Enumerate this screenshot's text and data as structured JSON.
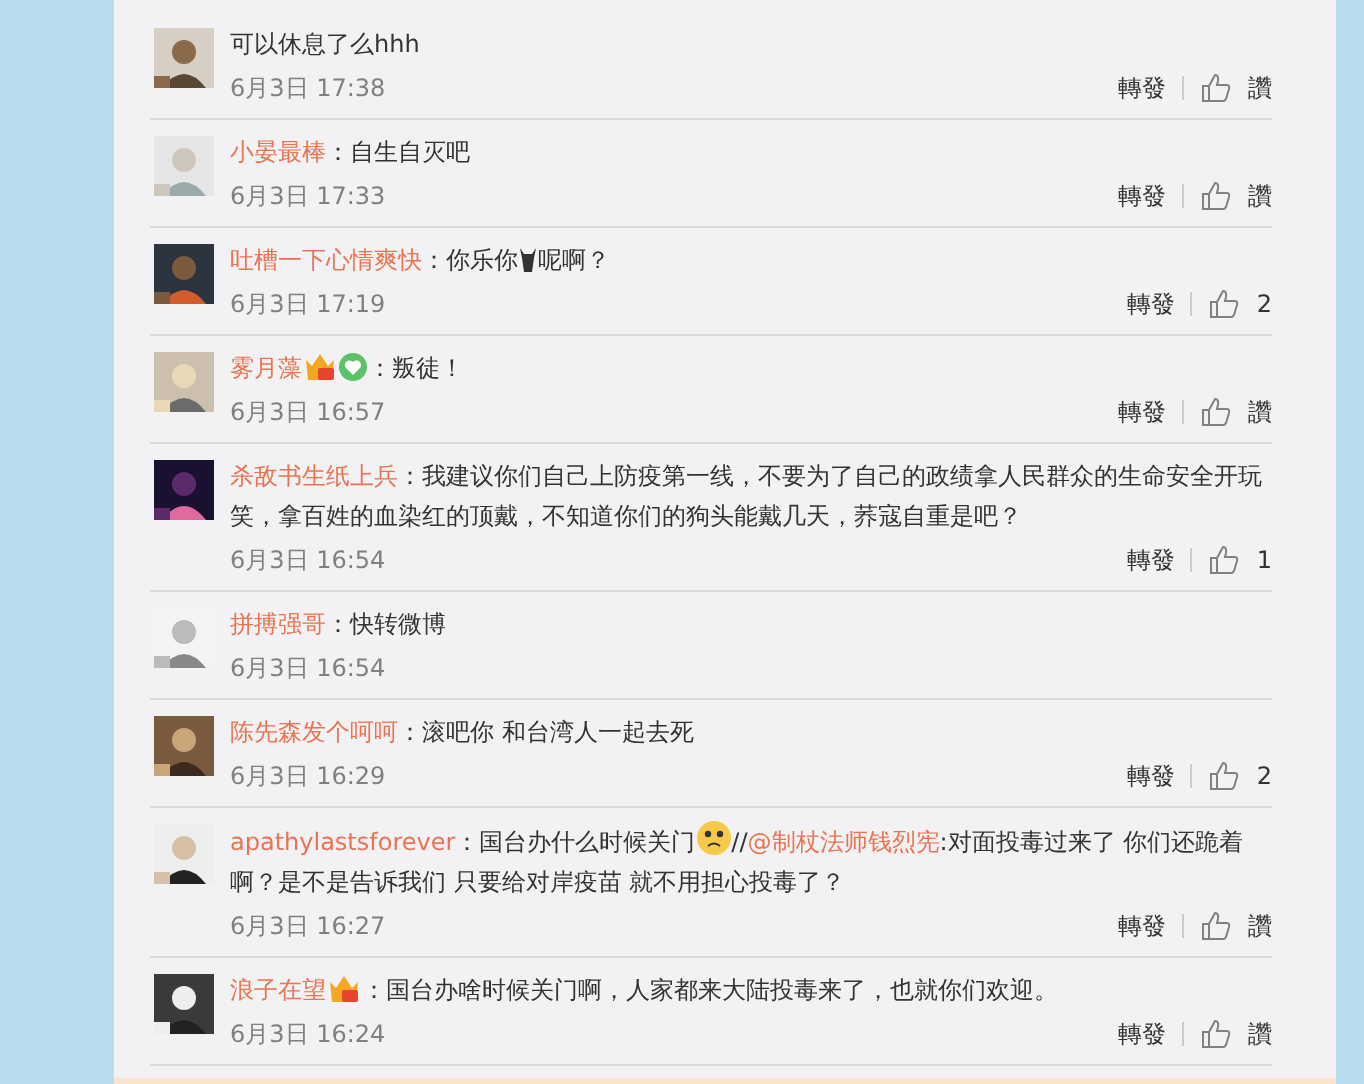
{
  "comments": [
    {
      "segments": [
        {
          "kind": "text",
          "text": "可以休息了么hhh"
        }
      ],
      "time": "6月3日 17:38",
      "forward": "轉發",
      "like": "讚"
    },
    {
      "user": "小晏最棒",
      "segments": [
        {
          "kind": "text",
          "text": "：自生自灭吧"
        }
      ],
      "time": "6月3日 17:33",
      "forward": "轉發",
      "like": "讚"
    },
    {
      "user": "吐槽一下心情爽快",
      "segments": [
        {
          "kind": "text",
          "text": "：你乐你"
        },
        {
          "kind": "emoji"
        },
        {
          "kind": "text",
          "text": "呢啊？"
        }
      ],
      "time": "6月3日 17:19",
      "forward": "轉發",
      "like": "2"
    },
    {
      "user": "雾月藻",
      "badges": [
        {
          "kind": "crown"
        },
        {
          "kind": "heart"
        }
      ],
      "segments": [
        {
          "kind": "text",
          "text": "：叛徒！"
        }
      ],
      "time": "6月3日 16:57",
      "forward": "轉發",
      "like": "讚"
    },
    {
      "user": "杀敌书生纸上兵",
      "segments": [
        {
          "kind": "text",
          "text": "：我建议你们自己上防疫第一线，不要为了自己的政绩拿人民群众的生命安全开玩笑，拿百姓的血染红的顶戴，不知道你们的狗头能戴几天，荞寇自重是吧？"
        }
      ],
      "time": "6月3日 16:54",
      "forward": "轉發",
      "like": "1"
    },
    {
      "user": "拼搏强哥",
      "segments": [
        {
          "kind": "text",
          "text": "：快转微博"
        }
      ],
      "time": "6月3日 16:54"
    },
    {
      "user": "陈先森发个呵呵",
      "segments": [
        {
          "kind": "text",
          "text": "：滚吧你 和台湾人一起去死"
        }
      ],
      "time": "6月3日 16:29",
      "forward": "轉發",
      "like": "2"
    },
    {
      "user": "apathylastsforever",
      "segments": [
        {
          "kind": "text",
          "text": "：国台办什么时候关门"
        },
        {
          "kind": "sad"
        },
        {
          "kind": "text",
          "text": "//"
        },
        {
          "kind": "mention",
          "text": "@制杖法师钱烈宪"
        },
        {
          "kind": "text",
          "text": ":对面投毒过来了 你们还跪着啊？是不是告诉我们 只要给对岸疫苗 就不用担心投毒了？"
        }
      ],
      "time": "6月3日 16:27",
      "forward": "轉發",
      "like": "讚"
    },
    {
      "user": "浪子在望",
      "badges": [
        {
          "kind": "crown"
        }
      ],
      "segments": [
        {
          "kind": "text",
          "text": "：国台办啥时候关门啊，人家都来大陆投毒来了，也就你们欢迎。"
        }
      ],
      "time": "6月3日 16:24",
      "forward": "轉發",
      "like": "讚"
    }
  ]
}
